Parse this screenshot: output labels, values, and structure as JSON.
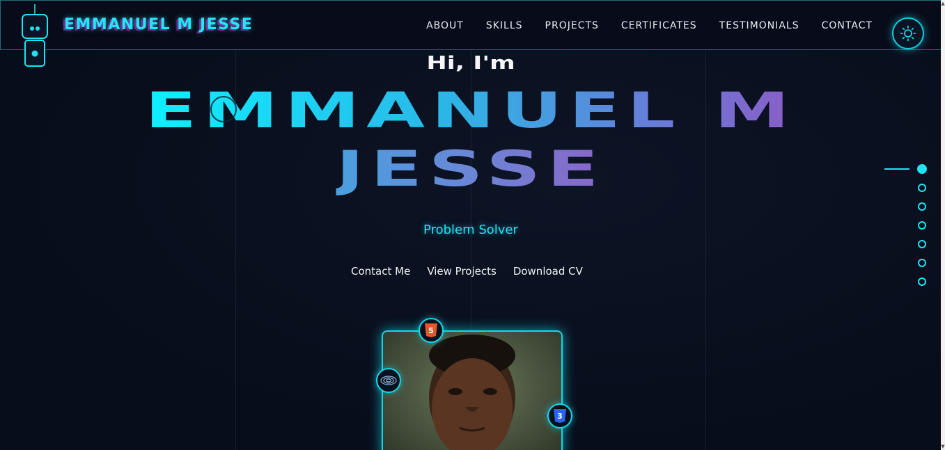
{
  "header": {
    "brand": "EMMANUEL M JESSE",
    "nav": [
      "ABOUT",
      "SKILLS",
      "PROJECTS",
      "CERTIFICATES",
      "TESTIMONIALS",
      "CONTACT"
    ]
  },
  "hero": {
    "greeting": "Hi, I'm",
    "name_line1": "EMMANUEL M",
    "name_line2": "JESSE",
    "role": "Problem Solver",
    "actions": [
      "Contact Me",
      "View Projects",
      "Download CV"
    ]
  },
  "side_nav": {
    "active_index": 0,
    "count": 7
  },
  "portrait": {
    "badges": [
      "html5-icon",
      "target-icon",
      "css3-icon"
    ]
  },
  "colors": {
    "accent": "#1de4f2",
    "background": "#0a0f1e",
    "glitch": "#c828dc"
  }
}
